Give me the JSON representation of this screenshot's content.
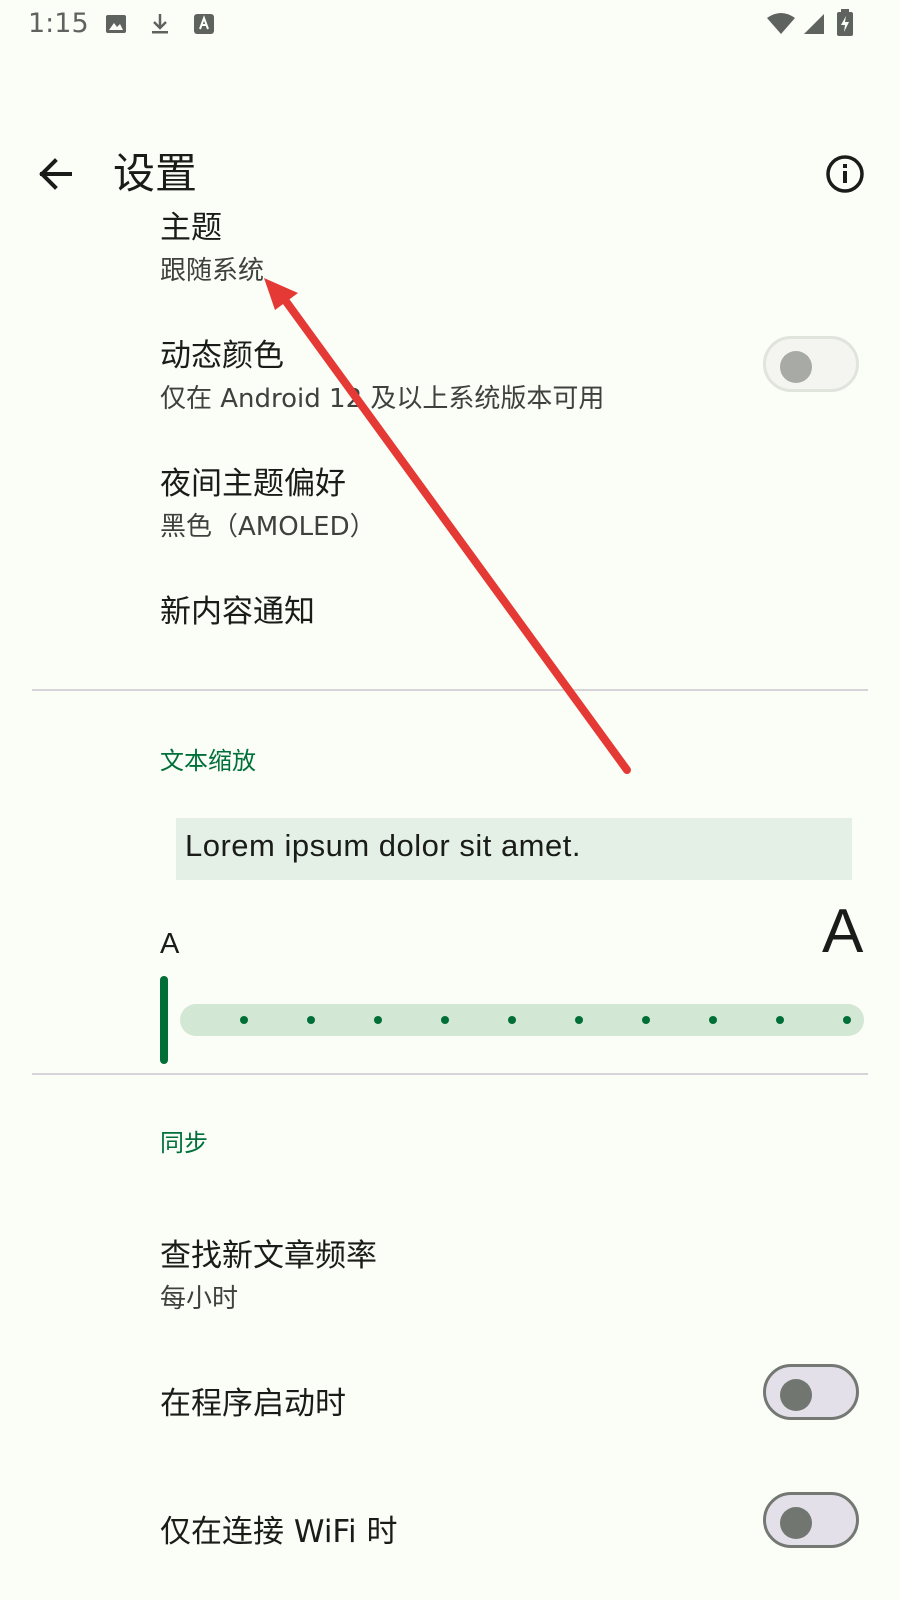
{
  "status_bar": {
    "time": "1:15",
    "left_icons": [
      "image-icon",
      "download-icon",
      "text-a-icon"
    ],
    "right_icons": [
      "wifi-icon",
      "signal-icon",
      "battery-charging-icon"
    ]
  },
  "app_bar": {
    "title": "设置",
    "back_icon": "arrow-left-icon",
    "info_icon": "info-icon"
  },
  "appearance": {
    "theme": {
      "title": "主题",
      "value": "跟随系统"
    },
    "dynamic_color": {
      "title": "动态颜色",
      "subtitle": "仅在 Android 12 及以上系统版本可用",
      "enabled": false,
      "disabled": true
    },
    "night_theme": {
      "title": "夜间主题偏好",
      "value": "黑色（AMOLED）"
    },
    "notifications": {
      "title": "新内容通知"
    }
  },
  "text_scaling": {
    "header": "文本缩放",
    "preview": "Lorem ipsum dolor sit amet.",
    "small_label": "A",
    "large_label": "A",
    "slider_value": 0,
    "slider_steps": 10
  },
  "sync": {
    "header": "同步",
    "frequency": {
      "title": "查找新文章频率",
      "value": "每小时"
    },
    "on_start": {
      "title": "在程序启动时",
      "enabled": false
    },
    "wifi_only": {
      "title": "仅在连接 WiFi 时",
      "enabled": false
    }
  },
  "colors": {
    "accent": "#006e37",
    "annotation_arrow": "#e53935",
    "background": "#fbfdf7"
  }
}
